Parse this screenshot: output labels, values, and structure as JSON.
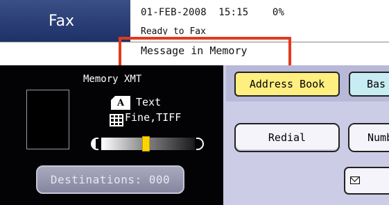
{
  "header": {
    "title": "Fax",
    "date": "01-FEB-2008",
    "time": "15:15",
    "memory_usage": "0%",
    "ready_status": "Ready to Fax",
    "message": "Message in Memory",
    "highlight_color": "#e23a1c"
  },
  "left_panel": {
    "mode_label": "Memory XMT",
    "original_type_icon": "A",
    "original_type": "Text",
    "resolution_icon": "grid-icon",
    "resolution": "Fine,TIFF",
    "contrast_level": 0.48,
    "destinations_label": "Destinations: 000"
  },
  "right_panel": {
    "tabs": [
      {
        "label": "Address Book",
        "selected": true
      },
      {
        "label": "Bas",
        "selected": false
      }
    ],
    "buttons": {
      "redial": "Redial",
      "number": "Numb"
    },
    "mail_icon": "envelope-icon"
  },
  "colors": {
    "title_bar": "#1e3168",
    "dark_panel": "#030306",
    "lavender_panel": "#cccce6",
    "selected_tab": "#ffee80",
    "basic_tab": "#c7ecf2",
    "contrast_knob": "#ffd400"
  }
}
